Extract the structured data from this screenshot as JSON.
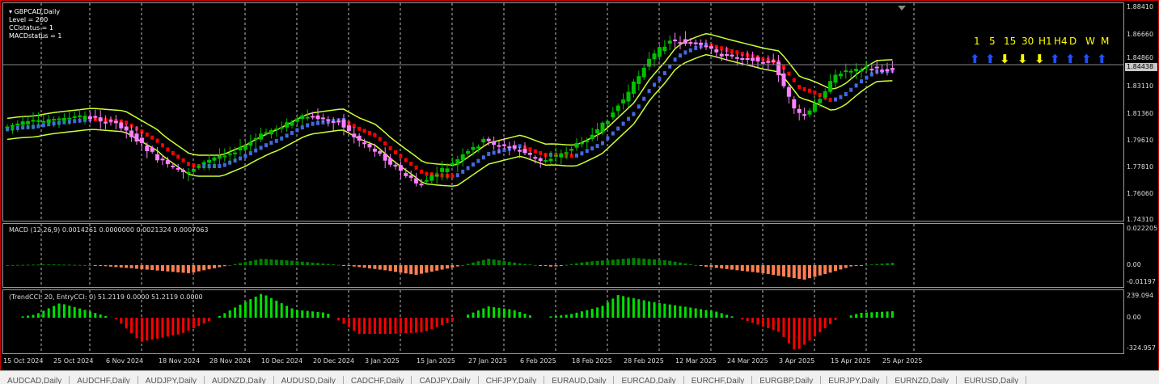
{
  "chart_title": "GBPCAD,Daily",
  "indicator_params": [
    "Level = 200",
    "CCIstatus = 1",
    "MACDstatus = 1"
  ],
  "current_price": "1.84438",
  "price_scale": [
    "1.88410",
    "1.86660",
    "1.84860",
    "1.83110",
    "1.81360",
    "1.79610",
    "1.77810",
    "1.76060",
    "1.74310"
  ],
  "macd": {
    "title": "MACD  (12,26,9) 0.0014261 0.0000000 0.0021324 0.0007063",
    "scale": [
      "0.022205",
      "0.00",
      "-0.01197"
    ]
  },
  "cci": {
    "title": "(TrendCCI: 20, EntryCCI: 0)  51.2119 0.0000 51.2119 0.0000",
    "scale": [
      "239.094",
      "0.00",
      "-324.957"
    ]
  },
  "dates": [
    "15 Oct 2024",
    "25 Oct 2024",
    "6 Nov 2024",
    "18 Nov 2024",
    "28 Nov 2024",
    "10 Dec 2024",
    "20 Dec 2024",
    "3 Jan 2025",
    "15 Jan 2025",
    "27 Jan 2025",
    "6 Feb 2025",
    "18 Feb 2025",
    "28 Feb 2025",
    "12 Mar 2025",
    "24 Mar 2025",
    "3 Apr 2025",
    "15 Apr 2025",
    "25 Apr 2025"
  ],
  "timeframes": [
    {
      "label": "1",
      "arrow": "up",
      "color": "#1e50ff"
    },
    {
      "label": "5",
      "arrow": "up",
      "color": "#1e50ff"
    },
    {
      "label": "15",
      "arrow": "down",
      "color": "#ffff00"
    },
    {
      "label": "30",
      "arrow": "down",
      "color": "#ffff00"
    },
    {
      "label": "H1",
      "arrow": "down",
      "color": "#ffff00"
    },
    {
      "label": "H4",
      "arrow": "up",
      "color": "#1e50ff"
    },
    {
      "label": "D",
      "arrow": "up",
      "color": "#1e50ff"
    },
    {
      "label": "W",
      "arrow": "up",
      "color": "#1e50ff"
    },
    {
      "label": "M",
      "arrow": "up",
      "color": "#1e50ff"
    }
  ],
  "symbol_tabs": [
    "AUDCAD,Daily",
    "AUDCHF,Daily",
    "AUDJPY,Daily",
    "AUDNZD,Daily",
    "AUDUSD,Daily",
    "CADCHF,Daily",
    "CADJPY,Daily",
    "CHFJPY,Daily",
    "EURAUD,Daily",
    "EURCAD,Daily",
    "EURCHF,Daily",
    "EURGBP,Daily",
    "EURJPY,Daily",
    "EURNZD,Daily",
    "EURUSD,Daily"
  ],
  "colors": {
    "bull_candle": "#00c000",
    "bear_candle": "#ff80ff",
    "band": "#ccff33",
    "ma_up": "#4169e1",
    "ma_down": "#ff0000",
    "macd_pos": "#008000",
    "macd_neg": "#ff7f50",
    "cci_pos": "#00e000",
    "cci_neg": "#ff0000"
  }
}
